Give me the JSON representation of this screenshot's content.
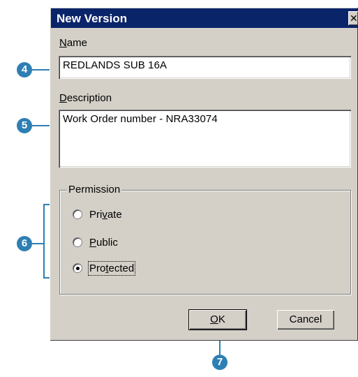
{
  "dialog": {
    "title": "New Version",
    "close_glyph": "✕",
    "name_label_u": "N",
    "name_label_rest": "ame",
    "name_value": "REDLANDS SUB 16A",
    "description_label_u": "D",
    "description_label_rest": "escription",
    "description_value": "Work Order number - NRA33074",
    "permission_label": "Permission",
    "radios": [
      {
        "pre": "Pri",
        "u": "v",
        "post": "ate",
        "checked": false
      },
      {
        "pre": "",
        "u": "P",
        "post": "ublic",
        "checked": false
      },
      {
        "pre": "Pro",
        "u": "t",
        "post": "ected",
        "checked": true
      }
    ],
    "ok_u": "O",
    "ok_rest": "K",
    "cancel_label": "Cancel"
  },
  "callouts": [
    "4",
    "5",
    "6",
    "7"
  ],
  "colors": {
    "title_bar": "#0a246a",
    "dialog_bg": "#d4d0c8",
    "callout": "#2e7fb3"
  }
}
